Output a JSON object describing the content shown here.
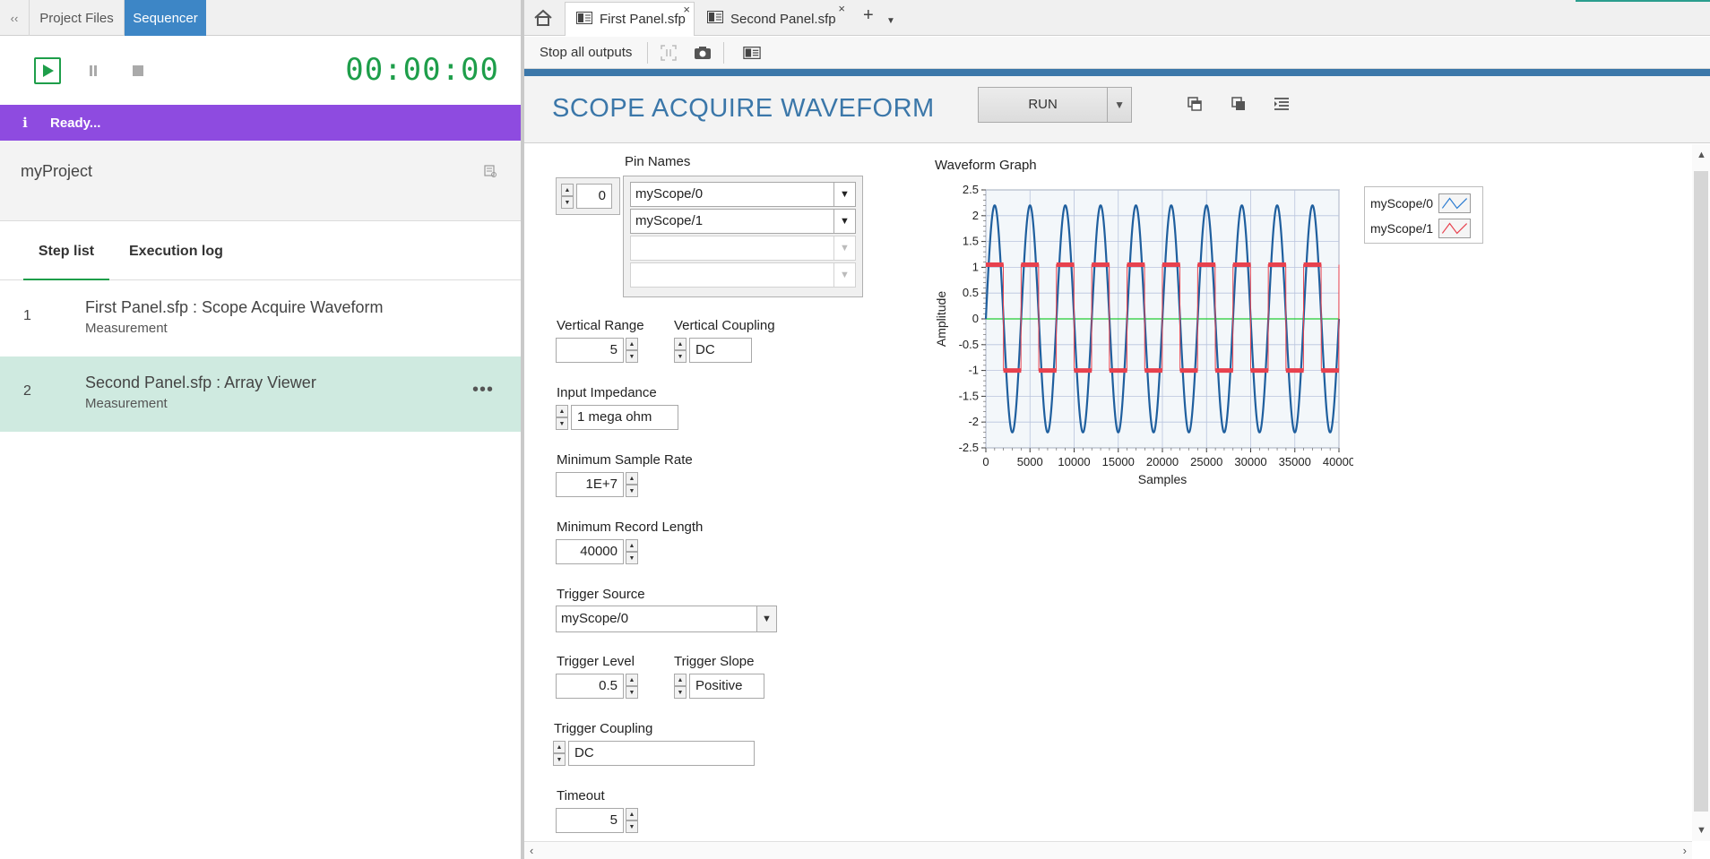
{
  "left": {
    "collapse_icon": "double-chevron-left-icon",
    "tabs": [
      "Project Files",
      "Sequencer"
    ],
    "timer": "00:00:00",
    "status": {
      "icon": "info-icon",
      "text": "Ready...",
      "color": "#8e4be0"
    },
    "project_name": "myProject",
    "step_tabs": [
      "Step list",
      "Execution log"
    ],
    "steps": [
      {
        "num": "1",
        "title": "First Panel.sfp : Scope Acquire Waveform",
        "sub": "Measurement",
        "selected": false
      },
      {
        "num": "2",
        "title": "Second Panel.sfp : Array Viewer",
        "sub": "Measurement",
        "selected": true,
        "more": "•••"
      }
    ]
  },
  "right": {
    "doc_tabs": [
      {
        "label": "First Panel.sfp",
        "close": "×",
        "active": true
      },
      {
        "label": "Second Panel.sfp",
        "close": "×",
        "active": false
      }
    ],
    "add_tab": "+",
    "toolbar": {
      "stop_all": "Stop all outputs"
    },
    "panel_title": "SCOPE ACQUIRE WAVEFORM",
    "run_label": "RUN",
    "controls": {
      "pin_names_label": "Pin Names",
      "pin_index": "0",
      "pins": [
        "myScope/0",
        "myScope/1",
        "",
        ""
      ],
      "vertical_range_label": "Vertical Range",
      "vertical_range": "5",
      "vertical_coupling_label": "Vertical Coupling",
      "vertical_coupling": "DC",
      "input_impedance_label": "Input Impedance",
      "input_impedance": "1 mega ohm",
      "min_sample_rate_label": "Minimum Sample Rate",
      "min_sample_rate": "1E+7",
      "min_record_length_label": "Minimum Record Length",
      "min_record_length": "40000",
      "trigger_source_label": "Trigger Source",
      "trigger_source": "myScope/0",
      "trigger_level_label": "Trigger Level",
      "trigger_level": "0.5",
      "trigger_slope_label": "Trigger Slope",
      "trigger_slope": "Positive",
      "trigger_coupling_label": "Trigger Coupling",
      "trigger_coupling": "DC",
      "timeout_label": "Timeout",
      "timeout": "5"
    },
    "graph_title": "Waveform Graph",
    "legend": [
      "myScope/0",
      "myScope/1"
    ]
  },
  "chart_data": {
    "type": "line",
    "title": "Waveform Graph",
    "xlabel": "Samples",
    "ylabel": "Amplitude",
    "xlim": [
      0,
      40000
    ],
    "ylim": [
      -2.5,
      2.5
    ],
    "xticks": [
      0,
      5000,
      10000,
      15000,
      20000,
      25000,
      30000,
      35000,
      40000
    ],
    "yticks": [
      2.5,
      2,
      1.5,
      1,
      0.5,
      0,
      -0.5,
      -1,
      -1.5,
      -2,
      -2.5
    ],
    "grid": true,
    "legend_position": "right",
    "series": [
      {
        "name": "myScope/0",
        "kind": "sine",
        "amplitude": 2.2,
        "offset": 0,
        "cycles": 10,
        "color": "#1f5f9e"
      },
      {
        "name": "myScope/1",
        "kind": "square",
        "high": 1.05,
        "low": -1.0,
        "cycles": 10,
        "color": "#e8414e"
      }
    ],
    "reference_line": {
      "y": 0,
      "color": "#22cc33"
    }
  }
}
